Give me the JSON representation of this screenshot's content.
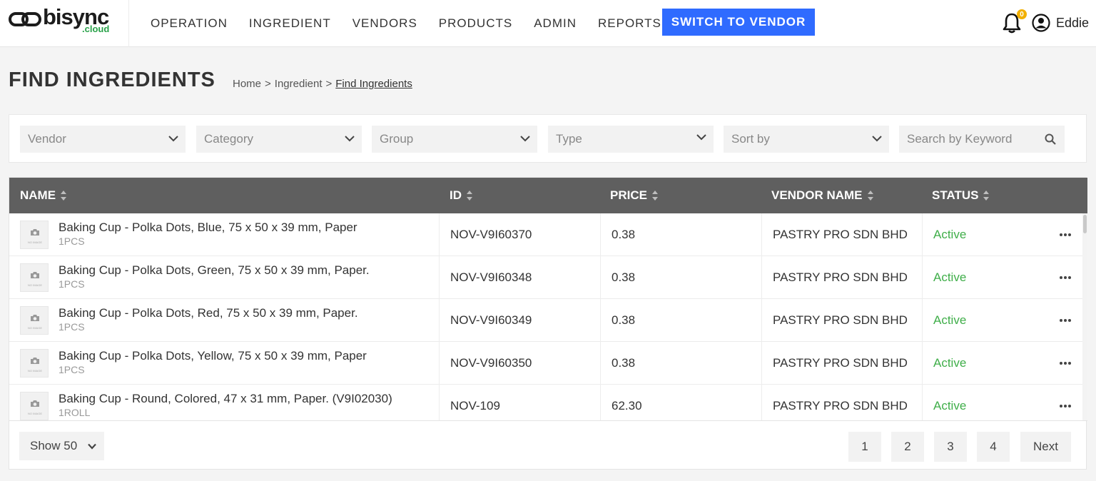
{
  "header": {
    "logo_text": "bisync",
    "logo_sub": ".cloud",
    "nav": [
      "OPERATION",
      "INGREDIENT",
      "VENDORS",
      "PRODUCTS",
      "ADMIN",
      "REPORTS"
    ],
    "switch_label": "SWITCH TO VENDOR",
    "notification_count": "0",
    "user_name": "Eddie",
    "accent_color": "#2f6bff"
  },
  "page": {
    "title": "FIND INGREDIENTS",
    "breadcrumb": [
      "Home",
      ">",
      "Ingredient",
      ">",
      "Find Ingredients"
    ]
  },
  "filters": {
    "vendor": "Vendor",
    "category": "Category",
    "group": "Group",
    "type": "Type",
    "sort": "Sort by",
    "search_placeholder": "Search by Keyword"
  },
  "table": {
    "columns": [
      "NAME",
      "ID",
      "PRICE",
      "VENDOR NAME",
      "STATUS"
    ],
    "no_image": "NO IMAGE",
    "rows": [
      {
        "name": "Baking Cup - Polka Dots, Blue, 75 x 50 x 39 mm, Paper",
        "unit": "1PCS",
        "id": "NOV-V9I60370",
        "price": "0.38",
        "vendor": "PASTRY PRO SDN BHD",
        "status": "Active"
      },
      {
        "name": "Baking Cup - Polka Dots, Green, 75 x 50 x 39 mm, Paper.",
        "unit": "1PCS",
        "id": "NOV-V9I60348",
        "price": "0.38",
        "vendor": "PASTRY PRO SDN BHD",
        "status": "Active"
      },
      {
        "name": "Baking Cup - Polka Dots, Red, 75 x 50 x 39 mm, Paper.",
        "unit": "1PCS",
        "id": "NOV-V9I60349",
        "price": "0.38",
        "vendor": "PASTRY PRO SDN BHD",
        "status": "Active"
      },
      {
        "name": "Baking Cup - Polka Dots, Yellow, 75 x 50 x 39 mm, Paper",
        "unit": "1PCS",
        "id": "NOV-V9I60350",
        "price": "0.38",
        "vendor": "PASTRY PRO SDN BHD",
        "status": "Active"
      },
      {
        "name": "Baking Cup - Round, Colored, 47 x 31 mm, Paper. (V9I02030)",
        "unit": "1ROLL",
        "id": "NOV-109",
        "price": "62.30",
        "vendor": "PASTRY PRO SDN BHD",
        "status": "Active"
      }
    ],
    "status_color": "#3fae49"
  },
  "pagination": {
    "show_label": "Show 50",
    "pages": [
      "1",
      "2",
      "3",
      "4"
    ],
    "next_label": "Next"
  }
}
